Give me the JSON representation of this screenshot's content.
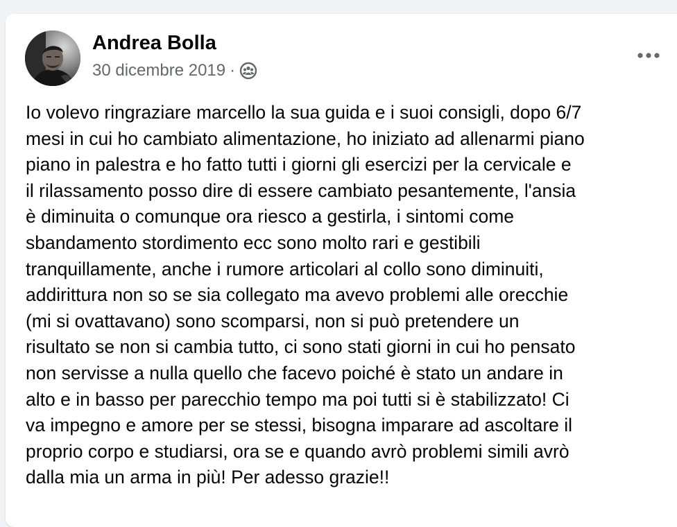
{
  "post": {
    "author": {
      "name": "Andrea Bolla",
      "avatar_icon": "profile-photo"
    },
    "meta": {
      "date": "30 dicembre 2019",
      "separator": "·",
      "audience_icon": "group-icon"
    },
    "more_icon": "more-horizontal-icon",
    "body": "Io volevo ringraziare marcello la sua guida e i suoi consigli, dopo 6/7\nmesi in cui ho cambiato alimentazione, ho iniziato ad allenarmi piano\npiano in palestra e ho fatto tutti i giorni gli esercizi per la cervicale e\nil rilassamento posso dire di essere cambiato pesantemente, l'ansia\nè diminuita o comunque ora riesco a gestirla, i sintomi come\nsbandamento stordimento ecc sono molto rari e gestibili\ntranquillamente, anche i rumore articolari al collo sono diminuiti,\naddirittura non so se sia collegato ma avevo problemi alle orecchie\n(mi si ovattavano) sono scomparsi, non si può pretendere un\nrisultato se non si cambia tutto, ci sono stati giorni in cui ho pensato\nnon servisse a nulla quello che facevo poiché è stato un andare in\nalto e in basso per parecchio tempo ma poi tutti si è stabilizzato! Ci\nva impegno e amore per se stessi, bisogna imparare ad ascoltare il\nproprio corpo e studiarsi, ora se e quando avrò problemi simili avrò\ndalla mia un arma in più! Per adesso grazie!!"
  },
  "colors": {
    "background": "#f0f2f5",
    "card": "#ffffff",
    "primary_text": "#050505",
    "secondary_text": "#65676b"
  }
}
